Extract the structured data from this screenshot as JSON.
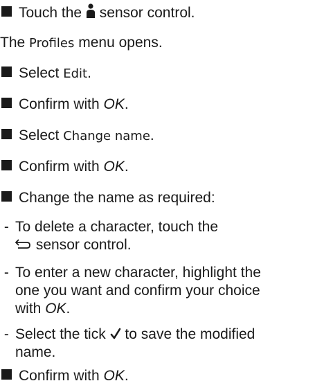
{
  "steps": [
    {
      "pre": "Touch the",
      "post": "sensor control.",
      "icon": "person-icon"
    },
    {
      "pre": "The",
      "ui": "Profiles",
      "post": "menu opens."
    },
    {
      "pre": "Select",
      "ui": "Edit",
      "post": "."
    },
    {
      "pre": "Confirm with",
      "it": "OK",
      "post": "."
    },
    {
      "pre": "Select",
      "ui": "Change name",
      "post": "."
    },
    {
      "pre": "Confirm with",
      "it": "OK",
      "post": "."
    },
    {
      "text": "Change the name as required:"
    },
    {
      "line1": "To delete a character, touch the",
      "line2": "sensor control.",
      "icon": "back-arrow-icon"
    },
    {
      "line1": "To enter a new character, highlight the",
      "line2": "one you want and confirm your choice",
      "line3pre": "with",
      "it": "OK",
      "post": "."
    },
    {
      "pre": "Select the tick",
      "post": "to save the modified",
      "line2": "name.",
      "icon": "tick-icon"
    },
    {
      "pre": "Confirm with",
      "it": "OK",
      "post": "."
    }
  ],
  "colors": {
    "text": "#1a1a1a",
    "background": "#ffffff"
  }
}
